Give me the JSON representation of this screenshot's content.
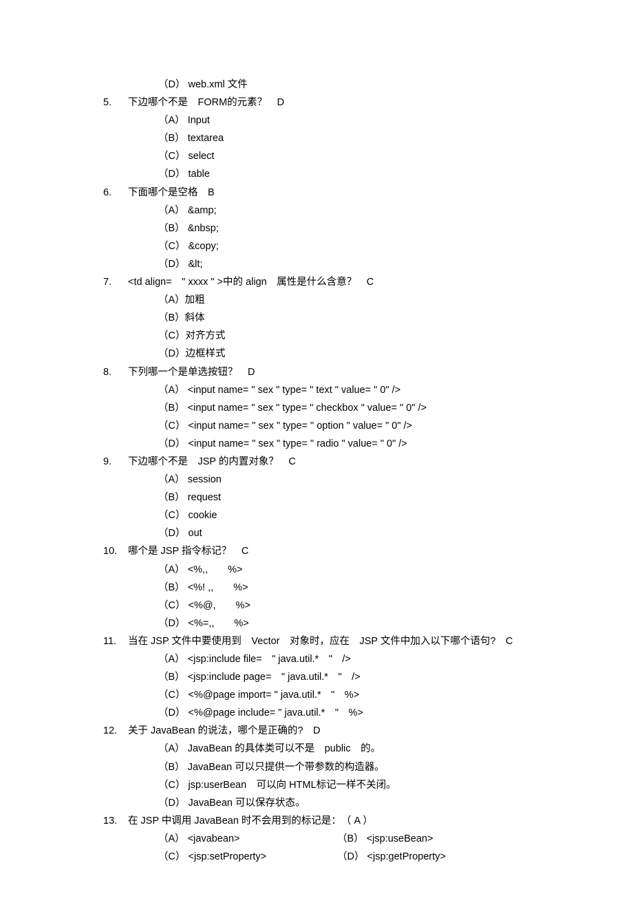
{
  "prefix_option": "（D） web.xml 文件",
  "questions": [
    {
      "num": "5.",
      "stem": "下边哪个不是　FORM的元素？　D",
      "opts": [
        "（A） Input",
        "（B） textarea",
        "（C） select",
        "（D） table"
      ]
    },
    {
      "num": "6.",
      "stem": "下面哪个是空格　B",
      "opts": [
        "（A） &amp;",
        "（B） &nbsp;",
        "（C） &copy;",
        "（D） &lt;"
      ]
    },
    {
      "num": "7.",
      "stem": "<td align=　\" xxxx \" >中的 align　属性是什么含意？　C",
      "opts": [
        "（A）加粗",
        "（B）斜体",
        "（C）对齐方式",
        "（D）边框样式"
      ]
    },
    {
      "num": "8.",
      "stem": "下列哪一个是单选按钮？　D",
      "opts": [
        "（A） <input name= \" sex \" type= \" text \" value= \" 0\" />",
        "（B） <input name= \" sex \" type= \" checkbox \" value= \" 0\" />",
        "（C） <input name= \" sex \" type= \" option \" value= \" 0\" />",
        "（D） <input name= \" sex \" type= \" radio \" value= \" 0\" />"
      ]
    },
    {
      "num": "9.",
      "stem": "下边哪个不是　JSP 的内置对象？　C",
      "opts": [
        "（A） session",
        "（B） request",
        "（C） cookie",
        "（D） out"
      ]
    },
    {
      "num": "10.",
      "stem": "哪个是 JSP 指令标记？　C",
      "opts": [
        "（A） <%,,　　%>",
        "（B） <%! ,,　　%>",
        "（C） <%@,　　%>",
        "（D） <%=,,　　%>"
      ]
    },
    {
      "num": "11.",
      "stem": "当在 JSP 文件中要使用到　Vector　对象时，应在　JSP 文件中加入以下哪个语句?　C",
      "opts": [
        "（A） <jsp:include file=　\" java.util.*　\"　/>",
        "（B） <jsp:include page=　\" java.util.*　\"　/>",
        "（C） <%@page import= \" java.util.*　\"　%>",
        "（D） <%@page include= \" java.util.*　\"　%>"
      ]
    },
    {
      "num": "12.",
      "stem": "关于 JavaBean 的说法，哪个是正确的?　D",
      "opts": [
        "（A） JavaBean 的具体类可以不是　public　的。",
        "（B） JavaBean 可以只提供一个带参数的构造器。",
        "（C） jsp:userBean　可以向 HTML标记一样不关闭。",
        "（D） JavaBean 可以保存状态。"
      ]
    },
    {
      "num": "13.",
      "stem": "在 JSP 中调用 JavaBean 时不会用到的标记是：　（ A ）",
      "dual": [
        {
          "l": "（A） <javabean>",
          "r": "（B） <jsp:useBean>"
        },
        {
          "l": "（C） <jsp:setProperty>",
          "r": "（D） <jsp:getProperty>"
        }
      ]
    }
  ]
}
